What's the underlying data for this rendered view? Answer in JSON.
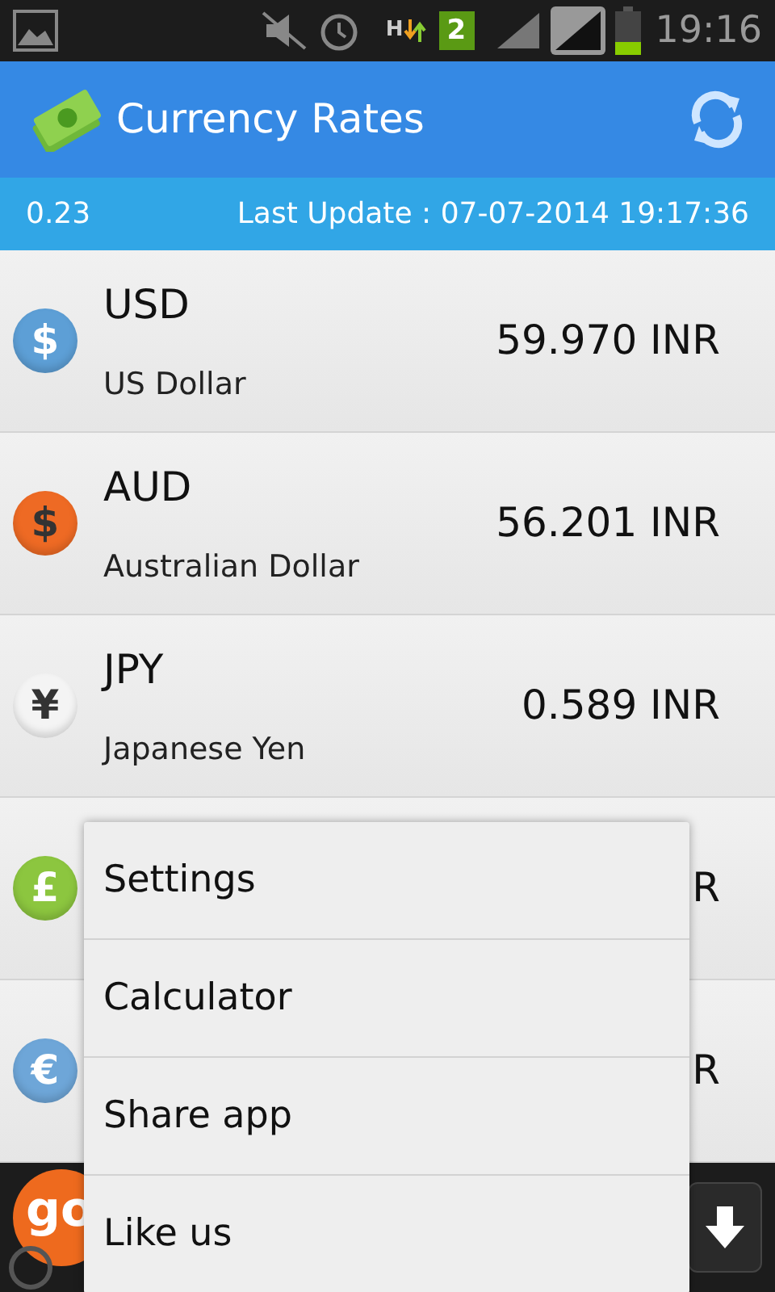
{
  "status_bar": {
    "network": "H",
    "sim": "2",
    "time": "19:16"
  },
  "app_bar": {
    "title": "Currency Rates"
  },
  "info_bar": {
    "value": "0.23",
    "last_update": "Last Update : 07-07-2014 19:17:36"
  },
  "rates": [
    {
      "symbol": "$",
      "color": "#5d9fd6",
      "code": "USD",
      "name": "US Dollar",
      "rate": "59.970 INR"
    },
    {
      "symbol": "$",
      "color": "#ee6a24",
      "code": "AUD",
      "name": "Australian Dollar",
      "rate": "56.201 INR"
    },
    {
      "symbol": "¥",
      "color": "#f4f4f4",
      "code": "JPY",
      "name": "Japanese Yen",
      "rate": "0.589 INR"
    },
    {
      "symbol": "£",
      "color": "#8cc63f",
      "rate": "R"
    },
    {
      "symbol": "€",
      "color": "#6ea6d8",
      "rate": "R"
    }
  ],
  "ad": {
    "logo": "go"
  },
  "menu": [
    {
      "label": "Settings"
    },
    {
      "label": "Calculator"
    },
    {
      "label": "Share app"
    },
    {
      "label": "Like us"
    }
  ]
}
